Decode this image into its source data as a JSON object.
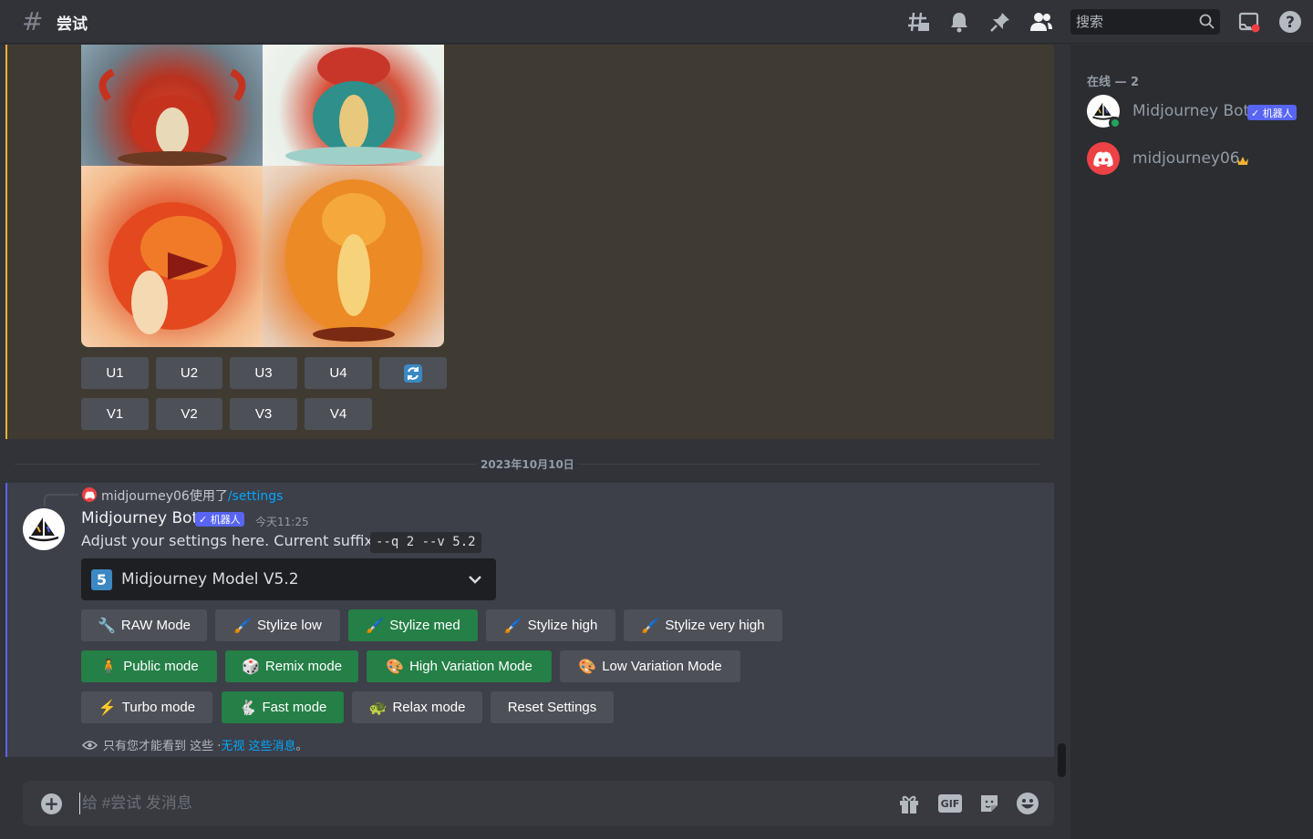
{
  "header": {
    "channel_name": "尝试",
    "search_placeholder": "搜索"
  },
  "previous_message": {
    "upscale_buttons": [
      "U1",
      "U2",
      "U3",
      "U4"
    ],
    "variation_buttons": [
      "V1",
      "V2",
      "V3",
      "V4"
    ]
  },
  "date_divider": "2023年10月10日",
  "message": {
    "reply_user": "midjourney06",
    "reply_used": "使用了",
    "reply_command": "/settings",
    "author": "Midjourney Bot",
    "bot_tag": "✓ 机器人",
    "timestamp": "今天11:25",
    "text": "Adjust your settings here. Current suffix:",
    "suffix_code": "--q 2 --v 5.2",
    "model_select": {
      "number": "5",
      "value": "Midjourney Model V5.2"
    },
    "buttons_row1": [
      {
        "label": "RAW Mode",
        "icon": "wrench-icon",
        "active": false
      },
      {
        "label": "Stylize low",
        "icon": "brush-icon",
        "active": false
      },
      {
        "label": "Stylize med",
        "icon": "brush-icon",
        "active": true
      },
      {
        "label": "Stylize high",
        "icon": "brush-icon",
        "active": false
      },
      {
        "label": "Stylize very high",
        "icon": "brush-icon",
        "active": false
      }
    ],
    "buttons_row2": [
      {
        "label": "Public mode",
        "icon": "person-icon",
        "active": true
      },
      {
        "label": "Remix mode",
        "icon": "dice-icon",
        "active": true
      },
      {
        "label": "High Variation Mode",
        "icon": "palette-icon",
        "active": true
      },
      {
        "label": "Low Variation Mode",
        "icon": "palette-icon",
        "active": false
      }
    ],
    "buttons_row3": [
      {
        "label": "Turbo mode",
        "icon": "lightning-icon",
        "active": false
      },
      {
        "label": "Fast mode",
        "icon": "rabbit-icon",
        "active": true
      },
      {
        "label": "Relax mode",
        "icon": "turtle-icon",
        "active": false
      },
      {
        "label": "Reset Settings",
        "icon": "",
        "active": false
      }
    ],
    "ephemeral_note": "只有您才能看到 这些 · ",
    "ephemeral_dismiss": "无视 这些消息",
    "ephemeral_end": "。"
  },
  "composer": {
    "placeholder": "给 #尝试 发消息"
  },
  "members": {
    "heading": "在线 — 2",
    "list": [
      {
        "name": "Midjourney Bot",
        "tag": "✓ 机器人"
      },
      {
        "name": "midjourney06"
      }
    ]
  },
  "colors": {
    "accent": "#5865f2",
    "active_button": "#248046",
    "button": "#4e5058",
    "highlight_border": "#f0b232"
  }
}
